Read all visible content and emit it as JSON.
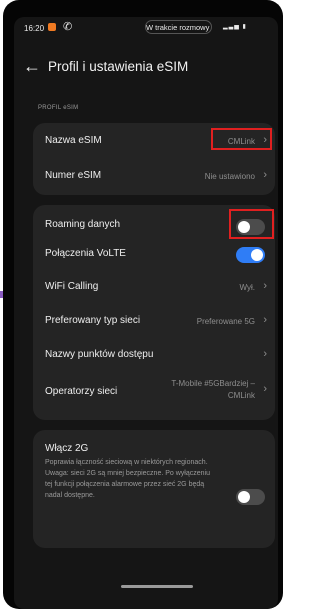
{
  "status": {
    "time": "16:20",
    "call_label": "W trakcie rozmowy"
  },
  "header": {
    "back_icon": "arrow-left-icon",
    "title": "Profil i ustawienia eSIM"
  },
  "section": {
    "label": "PROFIL eSIM"
  },
  "esim_card": {
    "name_label": "Nazwa eSIM",
    "name_value": "CMLink",
    "number_label": "Numer eSIM",
    "number_value": "Nie ustawiono"
  },
  "settings": {
    "roaming_label": "Roaming danych",
    "roaming_on": false,
    "volte_label": "Połączenia VoLTE",
    "volte_on": true,
    "wifi_label": "WiFi Calling",
    "wifi_value": "Wył.",
    "network_label": "Preferowany typ sieci",
    "network_value": "Preferowane 5G",
    "apn_label": "Nazwy punktów dostępu",
    "operators_label": "Operatorzy sieci",
    "operators_value_1": "T-Mobile #5GBardziej –",
    "operators_value_2": "CMLink"
  },
  "g2": {
    "title": "Włącz 2G",
    "description": "Poprawia łączność sieciową w niektórych regionach. Uwaga: sieci 2G są mniej bezpieczne. Po wyłączeniu tej funkcji połączenia alarmowe przez sieć 2G będą nadal dostępne.",
    "on": false
  },
  "colors": {
    "accent": "#2f7df6",
    "highlight": "#e02020",
    "card": "#242424",
    "background": "#151515"
  }
}
